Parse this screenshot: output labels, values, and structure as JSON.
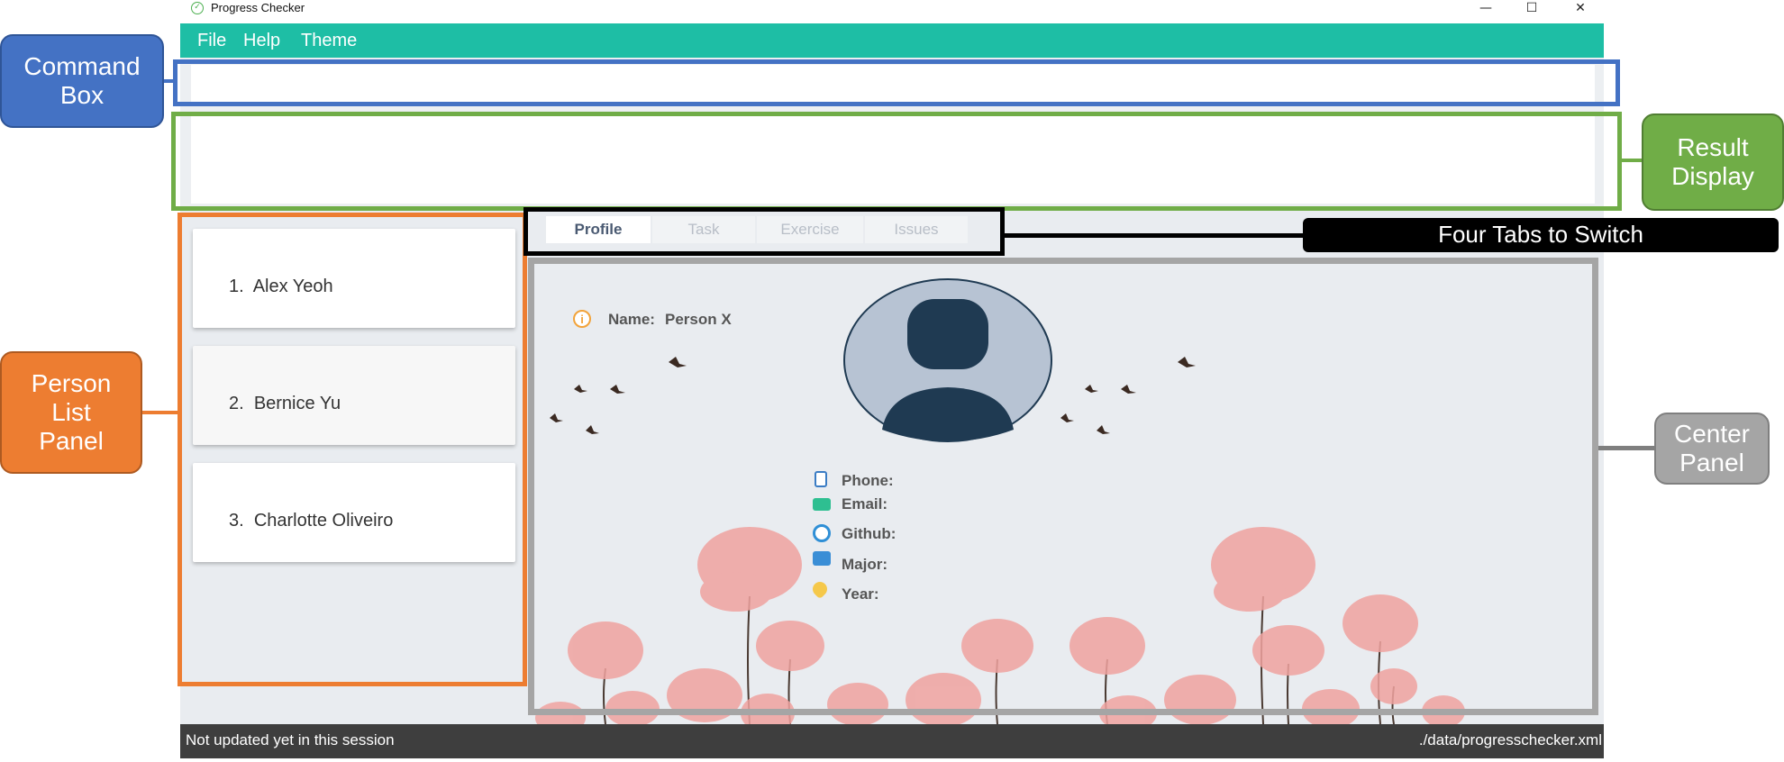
{
  "window": {
    "title": "Progress Checker",
    "controls": {
      "minimize": "—",
      "maximize": "☐",
      "close": "✕"
    }
  },
  "menu": {
    "items": [
      "File",
      "Help",
      "Theme"
    ]
  },
  "command_box": {
    "value": "",
    "placeholder": ""
  },
  "result_display": {
    "text": ""
  },
  "person_list": {
    "items": [
      {
        "index": "1.",
        "name": "Alex Yeoh"
      },
      {
        "index": "2.",
        "name": "Bernice Yu"
      },
      {
        "index": "3.",
        "name": "Charlotte Oliveiro"
      }
    ]
  },
  "tabs": [
    {
      "label": "Profile",
      "active": true
    },
    {
      "label": "Task",
      "active": false
    },
    {
      "label": "Exercise",
      "active": false
    },
    {
      "label": "Issues",
      "active": false
    }
  ],
  "profile": {
    "name_label": "Name:",
    "name_value": "Person X",
    "fields": [
      {
        "label": "Phone:",
        "icon": "phone-icon"
      },
      {
        "label": "Email:",
        "icon": "email-icon"
      },
      {
        "label": "Github:",
        "icon": "github-icon"
      },
      {
        "label": "Major:",
        "icon": "book-icon"
      },
      {
        "label": "Year:",
        "icon": "heart-icon"
      }
    ]
  },
  "status_bar": {
    "left": "Not updated yet in this session",
    "right": "./data/progresschecker.xml"
  },
  "annotations": {
    "command_box": "Command\nBox",
    "result_display": "Result\nDisplay",
    "person_list_panel": "Person\nList\nPanel",
    "four_tabs": "Four Tabs to Switch",
    "center_panel": "Center\nPanel"
  },
  "colors": {
    "menubar": "#1ebea5",
    "command_box_annotation": "#4472c4",
    "result_display_annotation": "#70ad47",
    "person_list_annotation": "#ed7d31",
    "tabs_annotation": "#000000",
    "center_panel_annotation": "#a5a5a5"
  }
}
